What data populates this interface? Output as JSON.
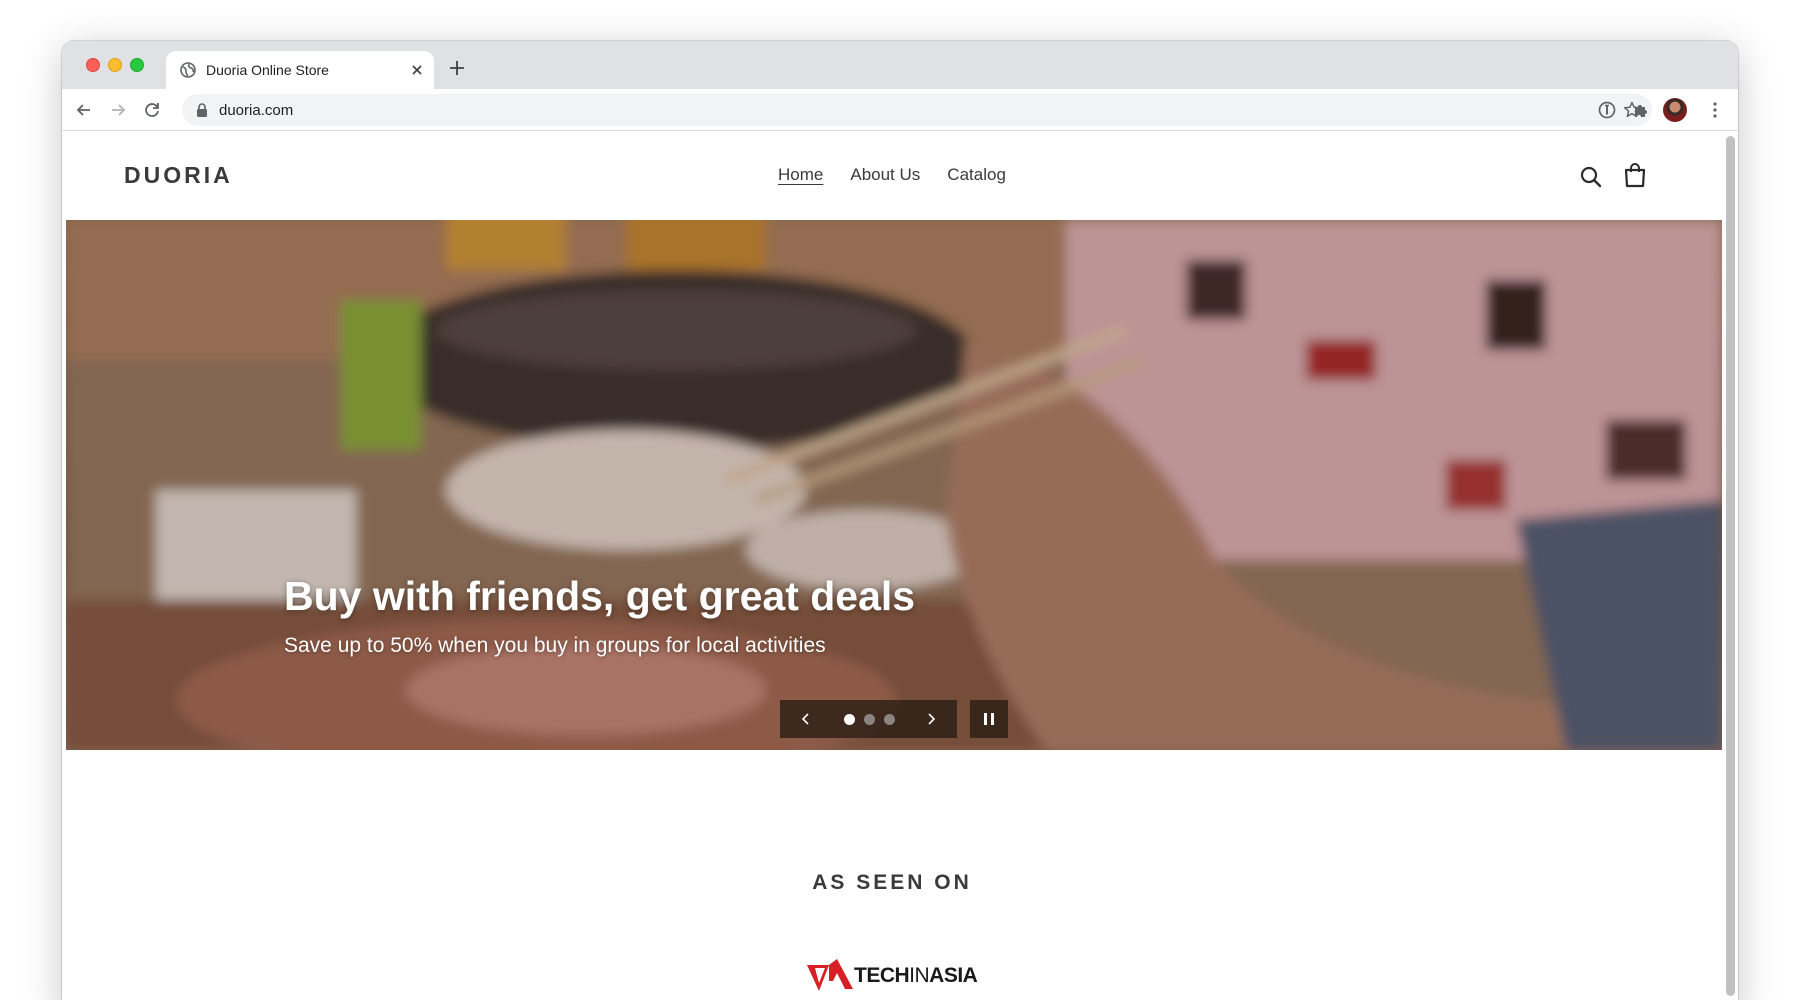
{
  "browser": {
    "tab_title": "Duoria Online Store",
    "url": "duoria.com"
  },
  "site": {
    "logo": "DUORIA",
    "nav": [
      "Home",
      "About Us",
      "Catalog"
    ],
    "active_nav": "Home"
  },
  "hero": {
    "headline": "Buy with friends, get great deals",
    "subheadline": "Save up to 50% when you buy in groups for local activities",
    "slide_count": 3,
    "active_slide": 1
  },
  "press": {
    "title": "AS SEEN ON",
    "logos": [
      {
        "name": "TECHINASIA",
        "parts": [
          "TECH",
          "IN",
          "ASIA"
        ],
        "accent": "#d71f26"
      }
    ]
  },
  "colors": {
    "text": "#3a3a3a",
    "tab_strip": "#dfe1e5",
    "omnibox": "#f1f3f4"
  }
}
